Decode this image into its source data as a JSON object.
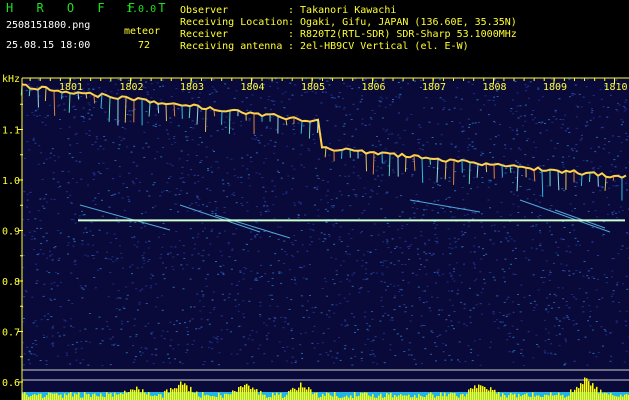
{
  "app": {
    "name": "H R O F F T",
    "version": "1.0.0"
  },
  "file": {
    "name": "2508151800.png",
    "datetime": "25.08.15 18:00"
  },
  "meteor": {
    "label": "meteor",
    "count": "72"
  },
  "info": [
    {
      "label": "Observer",
      "value": ": Takanori Kawachi"
    },
    {
      "label": "Receiving Location",
      "value": ": Ogaki, Gifu, JAPAN (136.60E, 35.35N)"
    },
    {
      "label": "Receiver",
      "value": ": R820T2(RTL-SDR) SDR-Sharp 53.1000MHz"
    },
    {
      "label": "Receiving antenna",
      "value": ": 2el-HB9CV Vertical (el. E-W)"
    }
  ],
  "y_axis": {
    "unit": "kHz",
    "ticks": [
      {
        "value": 1.1,
        "label": "1.1"
      },
      {
        "value": 1.0,
        "label": "1.0"
      },
      {
        "value": 0.9,
        "label": "0.9"
      },
      {
        "value": 0.8,
        "label": "0.8"
      },
      {
        "value": 0.7,
        "label": "0.7"
      },
      {
        "value": 0.6,
        "label": "0.6"
      }
    ]
  },
  "x_axis": {
    "ticks": [
      "1801",
      "1802",
      "1803",
      "1804",
      "1805",
      "1806",
      "1807",
      "1808",
      "1809",
      "1810"
    ]
  },
  "colors": {
    "background": "#0a0a3a",
    "label_yellow": "#ffff33",
    "title_green": "#1ee21e",
    "carrier": "#ccffcc",
    "activity_bars": "#ffff00",
    "baseline": "#22b4e6"
  }
}
